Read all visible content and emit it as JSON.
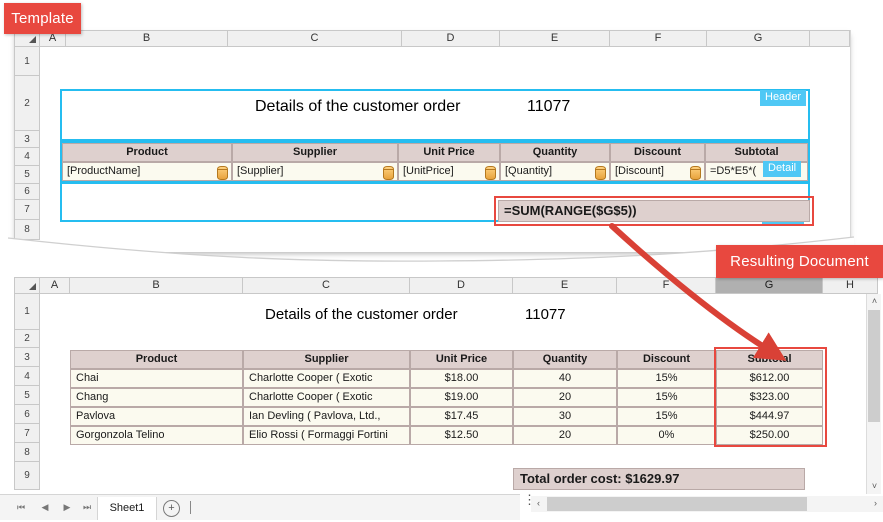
{
  "callouts": {
    "template_label": "Template",
    "resulting_label": "Resulting Document"
  },
  "template": {
    "columns": [
      "A",
      "B",
      "C",
      "D",
      "E",
      "F",
      "G"
    ],
    "rows": [
      "1",
      "2",
      "3",
      "4",
      "5",
      "6",
      "7",
      "8"
    ],
    "title": "Details of the customer order",
    "order_number": "11077",
    "bands": {
      "header": "Header",
      "detail": "Detail",
      "footer": "Footer"
    },
    "table_headers": [
      "Product",
      "Supplier",
      "Unit Price",
      "Quantity",
      "Discount",
      "Subtotal"
    ],
    "detail_row": [
      "[ProductName]",
      "[Supplier]",
      "[UnitPrice]",
      "[Quantity]",
      "[Discount]",
      "=D5*E5*("
    ],
    "footer_formula": "=SUM(RANGE($G$5))"
  },
  "result": {
    "columns": [
      "A",
      "B",
      "C",
      "D",
      "E",
      "F",
      "G",
      "H"
    ],
    "selected_column": "G",
    "rows": [
      "1",
      "2",
      "3",
      "4",
      "5",
      "6",
      "7",
      "8",
      "9"
    ],
    "title": "Details of the customer order",
    "order_number": "11077",
    "table_headers": [
      "Product",
      "Supplier",
      "Unit Price",
      "Quantity",
      "Discount",
      "Subtotal"
    ],
    "table_rows": [
      [
        "Chai",
        "Charlotte Cooper ( Exotic",
        "$18.00",
        "40",
        "15%",
        "$612.00"
      ],
      [
        "Chang",
        "Charlotte Cooper ( Exotic",
        "$19.00",
        "20",
        "15%",
        "$323.00"
      ],
      [
        "Pavlova",
        "Ian Devling ( Pavlova, Ltd.,",
        "$17.45",
        "30",
        "15%",
        "$444.97"
      ],
      [
        "Gorgonzola Telino",
        "Elio Rossi ( Formaggi Fortini",
        "$12.50",
        "20",
        "0%",
        "$250.00"
      ]
    ],
    "total_text": "Total order cost: $1629.97"
  },
  "tabbar": {
    "first_label": "⏮",
    "prev_label": "◀",
    "next_label": "▶",
    "last_label": "⏭",
    "sheet_name": "Sheet1",
    "add_label": "+"
  },
  "scrollbars": {
    "up_label": "˄",
    "down_label": "˅",
    "left_label": "‹",
    "right_label": "›"
  },
  "colors": {
    "accent_red": "#e8483f",
    "band_cyan": "#25bdf0",
    "header_fill": "#ded0ce",
    "cell_fill": "#fbfaef"
  }
}
